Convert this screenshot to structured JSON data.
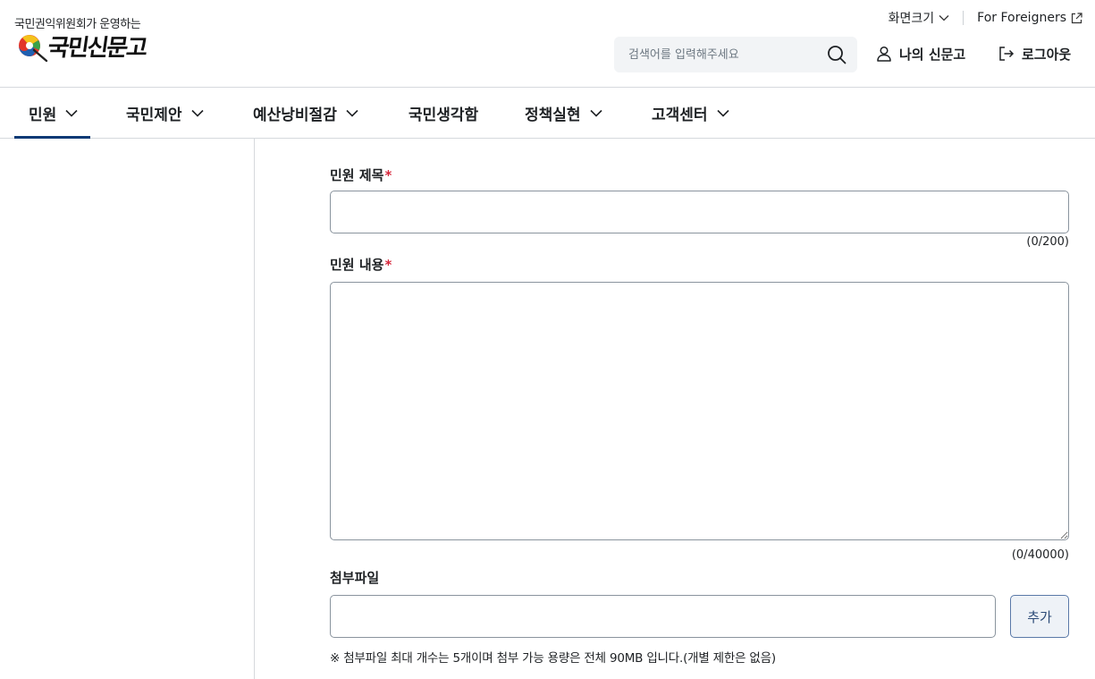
{
  "logo": {
    "subtitle": "국민권익위원회가 운영하는",
    "name": "국민신문고"
  },
  "utility": {
    "font_size_label": "화면크기",
    "foreigners_label": "For Foreigners"
  },
  "search": {
    "placeholder": "검색어를 입력해주세요"
  },
  "header_buttons": {
    "my_page": "나의 신문고",
    "logout": "로그아웃"
  },
  "gnb": {
    "items": [
      {
        "label": "민원",
        "has_dropdown": true,
        "active": true
      },
      {
        "label": "국민제안",
        "has_dropdown": true,
        "active": false
      },
      {
        "label": "예산낭비절감",
        "has_dropdown": true,
        "active": false
      },
      {
        "label": "국민생각함",
        "has_dropdown": false,
        "active": false
      },
      {
        "label": "정책실현",
        "has_dropdown": true,
        "active": false
      },
      {
        "label": "고객센터",
        "has_dropdown": true,
        "active": false
      }
    ]
  },
  "form": {
    "title_label": "민원 제목",
    "title_value": "",
    "title_counter": "(0/200)",
    "content_label": "민원 내용",
    "content_value": "",
    "content_counter": "(0/40000)",
    "required_mark": "*",
    "attach_label": "첨부파일",
    "attach_value": "",
    "add_button": "추가",
    "attach_notice": "※ 첨부파일 최대 개수는 5개이며 첨부 가능 용량은 전체 90MB 입니다.(개별 제한은 없음)"
  },
  "colors": {
    "accent": "#0b3a75",
    "required": "#d6273b",
    "search_bg": "#f2f4f6"
  }
}
